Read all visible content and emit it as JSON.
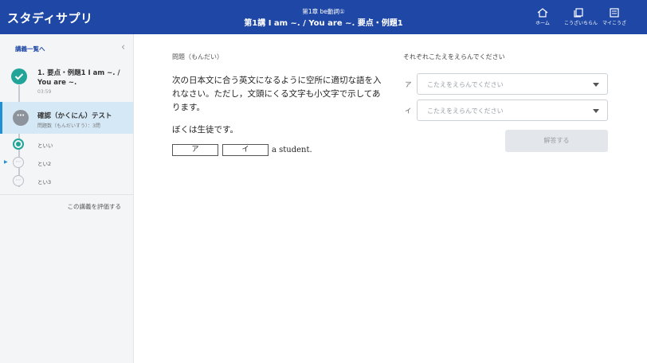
{
  "header": {
    "logo": "スタディサプリ",
    "chapter": "第1章 be動詞①",
    "title": "第1講 I am ~. / You are ~. 要点・例題1",
    "nav": [
      {
        "label": "ホーム",
        "icon": "home-icon"
      },
      {
        "label": "こうざいちらん",
        "icon": "courses-icon"
      },
      {
        "label": "マイこうざ",
        "icon": "my-course-icon"
      }
    ]
  },
  "sidebar": {
    "back_link": "講義一覧へ",
    "lesson": {
      "title": "1. 要点・例題1 I am ~. / You are ~.",
      "time": "03:59"
    },
    "test": {
      "title": "確認（かくにん）テスト",
      "sub": "問題数（もんだいすう）：3問"
    },
    "questions": [
      {
        "label": "といい"
      },
      {
        "label": "とい2"
      },
      {
        "label": "とい3"
      }
    ],
    "rate_link": "この講義を評価する"
  },
  "question": {
    "heading": "問題（もんだい）",
    "text": "次の日本文に合う英文になるように空所に適切な語を入れなさい。ただし，文頭にくる文字も小文字で示してあります。",
    "sentence": "ぼくは生徒です。",
    "blank_a": "ア",
    "blank_i": "イ",
    "tail": "a student."
  },
  "answers": {
    "instruction": "それぞれこたえをえらんでください",
    "label_a": "ア",
    "label_i": "イ",
    "placeholder_a": "こたえをえらんでください",
    "placeholder_i": "こたえをえらんでください",
    "submit": "解答する"
  },
  "colors": {
    "header": "#1f48a6",
    "accent": "#22a598",
    "selected_bg": "#d5e8f6"
  }
}
